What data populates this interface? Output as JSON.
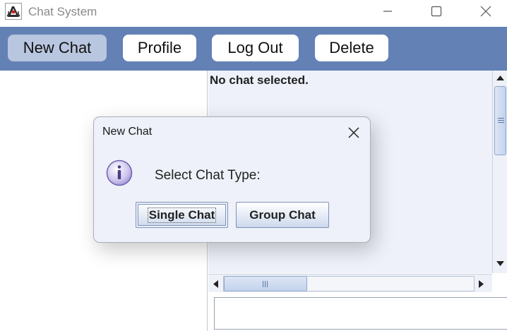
{
  "window": {
    "title": "Chat System",
    "app_icon": "java-duke-icon",
    "controls": [
      "minimize-icon",
      "maximize-icon",
      "close-icon"
    ]
  },
  "toolbar": {
    "background": "#6381b5",
    "new_chat_label": "New Chat",
    "profile_label": "Profile",
    "logout_label": "Log Out",
    "delete_label": "Delete"
  },
  "chat": {
    "status": "No chat selected.",
    "message_input_value": ""
  },
  "dialog": {
    "title": "New Chat",
    "icon": "info-icon",
    "message": "Select Chat Type:",
    "single_chat_label": "Single Chat",
    "group_chat_label": "Group Chat"
  }
}
